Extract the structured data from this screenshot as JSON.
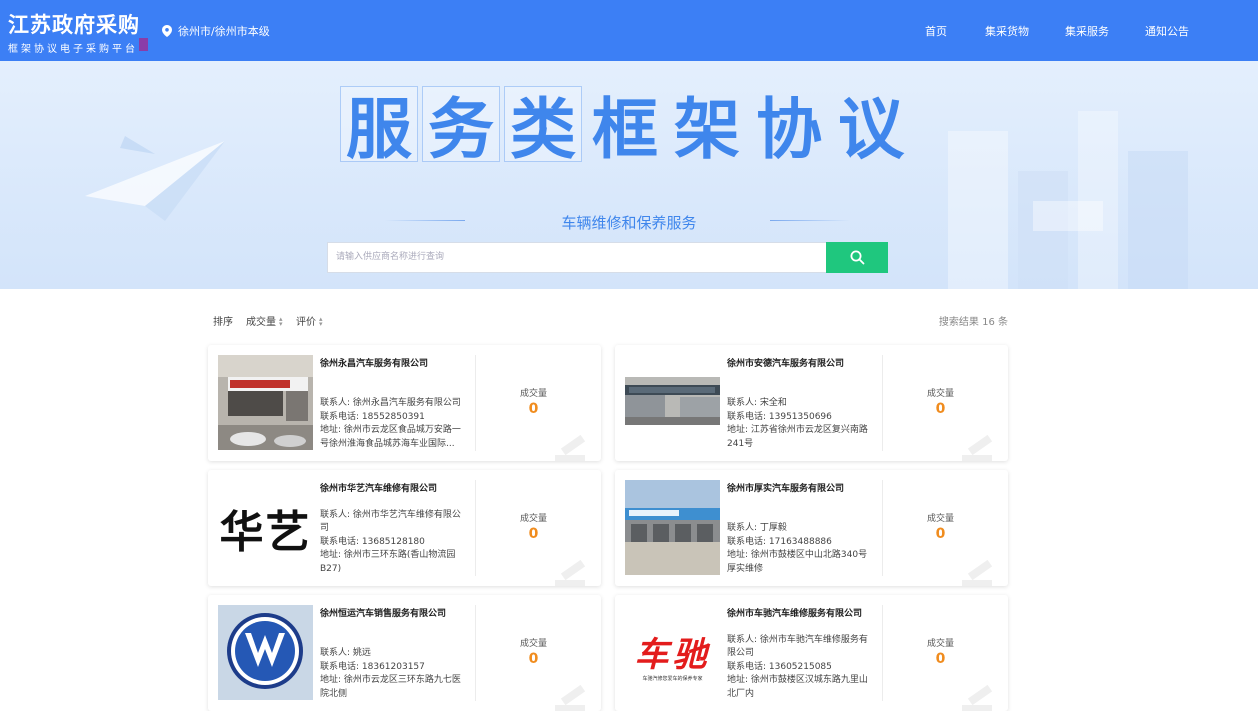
{
  "header": {
    "logo_title": "江苏政府采购",
    "logo_subtitle": "框架协议电子采购平台",
    "region": "徐州市/徐州市本级",
    "nav": [
      "首页",
      "集采货物",
      "集采服务",
      "通知公告"
    ]
  },
  "banner": {
    "title_chars": [
      "服",
      "务",
      "类",
      "框",
      "架",
      "协",
      "议"
    ],
    "subtitle": "车辆维修和保养服务",
    "search_placeholder": "请输入供应商名称进行查询"
  },
  "sortbar": {
    "label": "排序",
    "options": [
      "成交量",
      "评价"
    ],
    "result_text": "搜索结果 16 条"
  },
  "labels": {
    "deal": "成交量"
  },
  "suppliers": [
    {
      "name": "徐州永昌汽车服务有限公司",
      "contact": "联系人: 徐州永昌汽车服务有限公司",
      "phone": "联系电话: 18552850391",
      "address": "地址: 徐州市云龙区食品城万安路一号徐州淮海食品城苏海车业国际...",
      "deal": "0",
      "image": "storefront-photo"
    },
    {
      "name": "徐州市安德汽车服务有限公司",
      "contact": "联系人: 宋全和",
      "phone": "联系电话: 13951350696",
      "address": "地址: 江苏省徐州市云龙区复兴南路241号",
      "deal": "0",
      "image": "storefront-photo"
    },
    {
      "name": "徐州市华艺汽车维修有限公司",
      "contact": "联系人: 徐州市华艺汽车维修有限公司",
      "phone": "联系电话: 13685128180",
      "address": "地址: 徐州市三环东路(香山物流园B27)",
      "deal": "0",
      "image": "huayi-logo",
      "image_text": "华艺"
    },
    {
      "name": "徐州市厚实汽车服务有限公司",
      "contact": "联系人: 丁厚毅",
      "phone": "联系电话: 17163488886",
      "address": "地址: 徐州市鼓楼区中山北路340号厚实维修",
      "deal": "0",
      "image": "garage-photo"
    },
    {
      "name": "徐州恒运汽车销售服务有限公司",
      "contact": "联系人: 姚远",
      "phone": "联系电话: 18361203157",
      "address": "地址: 徐州市云龙区三环东路九七医院北侧",
      "deal": "0",
      "image": "vw-logo"
    },
    {
      "name": "徐州市车驰汽车维修服务有限公司",
      "contact": "联系人: 徐州市车驰汽车维修服务有限公司",
      "phone": "联系电话: 13605215085",
      "address": "地址: 徐州市鼓楼区汉城东路九里山北厂内",
      "deal": "0",
      "image": "chechi-logo",
      "image_text": "车驰",
      "image_tagline": "车驰汽修您爱车的保养专家"
    }
  ],
  "colors": {
    "header": "#3c7ff5",
    "accent": "#3f86ec",
    "search_button": "#1fc77e",
    "deal_value": "#f08c1e"
  }
}
